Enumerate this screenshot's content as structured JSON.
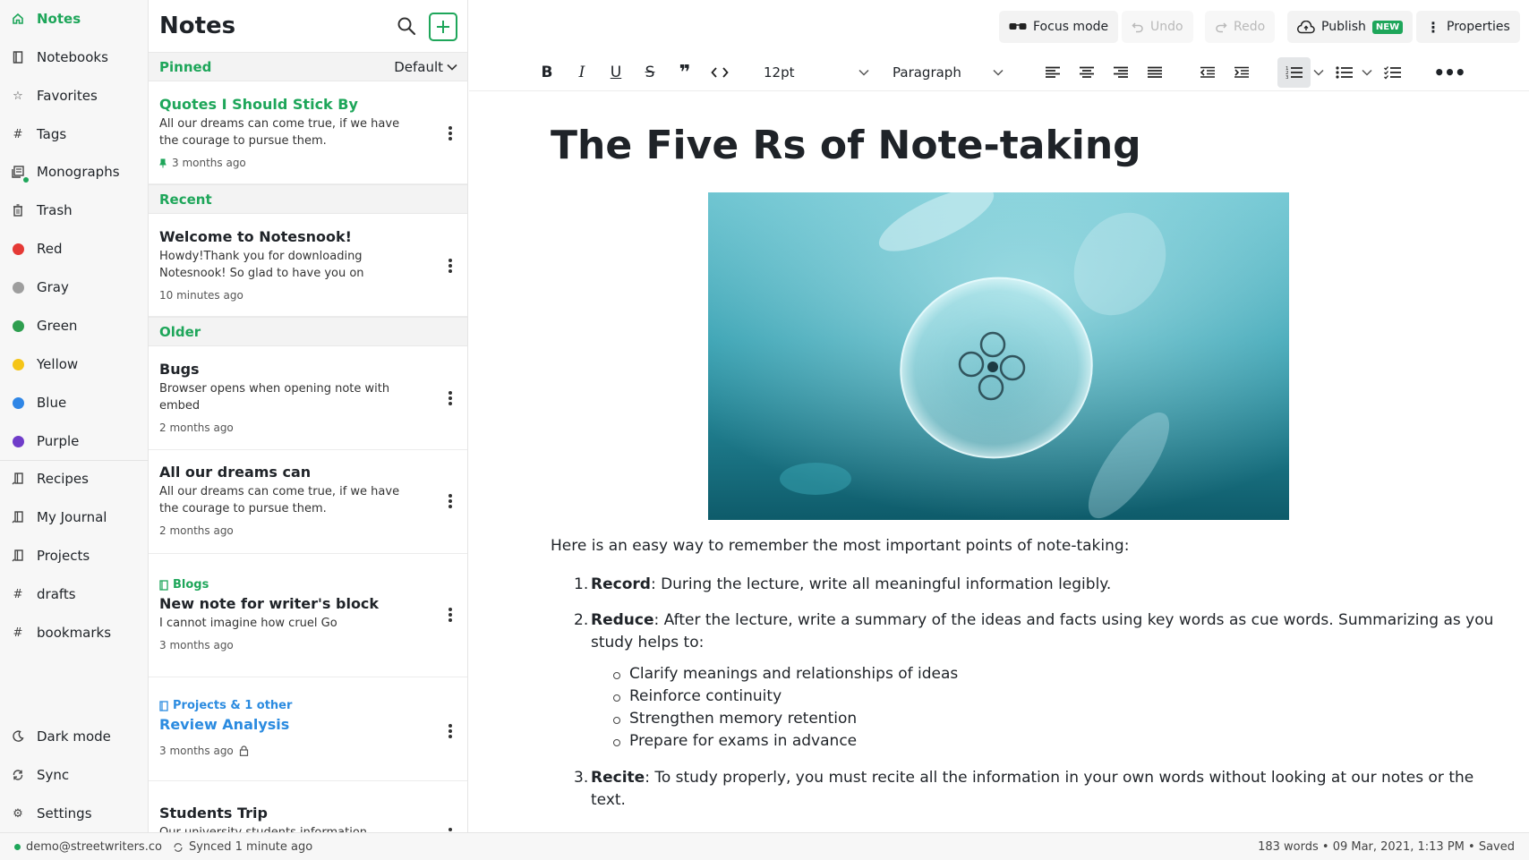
{
  "sidebar": {
    "items": [
      {
        "label": "Notes",
        "icon": "home-icon"
      },
      {
        "label": "Notebooks",
        "icon": "notebook-icon"
      },
      {
        "label": "Favorites",
        "icon": "star-icon"
      },
      {
        "label": "Tags",
        "icon": "hash-icon"
      },
      {
        "label": "Monographs",
        "icon": "monograph-icon"
      },
      {
        "label": "Trash",
        "icon": "trash-icon"
      },
      {
        "label": "Red",
        "color": "#e53935"
      },
      {
        "label": "Gray",
        "color": "#9e9e9e"
      },
      {
        "label": "Green",
        "color": "#2e9e4f"
      },
      {
        "label": "Yellow",
        "color": "#f5c518"
      },
      {
        "label": "Blue",
        "color": "#2f86e6"
      },
      {
        "label": "Purple",
        "color": "#6f3cc9"
      },
      {
        "label": "Recipes",
        "icon": "notebook-shortcut-icon"
      },
      {
        "label": "My Journal",
        "icon": "notebook-shortcut-icon"
      },
      {
        "label": "Projects",
        "icon": "notebook-shortcut-icon"
      },
      {
        "label": "drafts",
        "icon": "tag-shortcut-icon"
      },
      {
        "label": "bookmarks",
        "icon": "tag-shortcut-icon"
      }
    ],
    "bottom": [
      {
        "label": "Dark mode",
        "icon": "moon-icon"
      },
      {
        "label": "Sync",
        "icon": "sync-icon"
      },
      {
        "label": "Settings",
        "icon": "gear-icon"
      }
    ]
  },
  "notes_list": {
    "title": "Notes",
    "sections": {
      "pinned": "Pinned",
      "recent": "Recent",
      "older": "Older",
      "sort": "Default"
    },
    "notes": [
      {
        "title": "Quotes I Should Stick By",
        "body": "All our dreams can come true, if we have the courage to pursue them.",
        "meta": "3 months ago"
      },
      {
        "title": "Welcome to Notesnook!",
        "body": "Howdy!Thank you for downloading Notesnook! So glad to have you on",
        "meta": "10 minutes ago"
      },
      {
        "title": "Bugs",
        "body": "Browser opens when opening note with embed",
        "meta": "2 months ago"
      },
      {
        "title": "All our dreams can",
        "body": "All our dreams can come true, if we have the courage to pursue them.",
        "meta": "2 months ago"
      },
      {
        "tag": "Blogs",
        "title": "New note for writer's block",
        "body": "I cannot imagine how cruel Go",
        "meta": "3 months ago"
      },
      {
        "tag": "Projects & 1 other",
        "title": "Review Analysis",
        "meta": "3 months ago"
      },
      {
        "title": "Students Trip",
        "body": "Our university students information"
      }
    ]
  },
  "topbar": {
    "focus_mode": "Focus mode",
    "undo": "Undo",
    "redo": "Redo",
    "publish": "Publish",
    "new_badge": "NEW",
    "properties": "Properties"
  },
  "toolbar": {
    "font_size": "12pt",
    "block_type": "Paragraph"
  },
  "document": {
    "title": "The Five Rs of Note-taking",
    "intro": "Here is an easy way to remember the most important points of note-taking:",
    "items": [
      {
        "num": "1.",
        "term": "Record",
        "text": ": During the lecture, write all meaningful information legibly."
      },
      {
        "num": "2.",
        "term": "Reduce",
        "text": ": After the lecture, write a summary of the ideas and facts using key words as cue words. Summarizing as you",
        "text2": "study helps to:"
      },
      {
        "num": "3.",
        "term": "Recite",
        "text": ": To study properly, you must recite all the information in your own words without looking at our notes or the",
        "text2": "text."
      }
    ],
    "sub_items": [
      "Clarify meanings and relationships of ideas",
      "Reinforce continuity",
      "Strengthen memory retention",
      "Prepare for exams in advance"
    ]
  },
  "statusbar": {
    "email": "demo@streetwriters.co",
    "sync": "Synced 1 minute ago",
    "info": "183 words • 09 Mar, 2021, 1:13 PM • Saved"
  },
  "colors": {
    "accent": "#1ea65a",
    "link_blue": "#2b8be0"
  }
}
